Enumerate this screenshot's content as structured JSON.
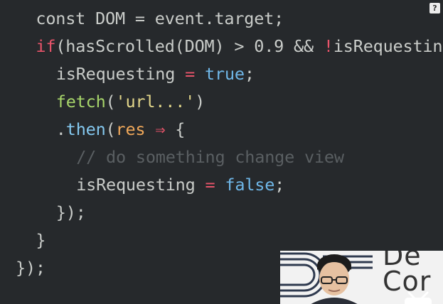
{
  "code_lines": [
    {
      "indent": 1,
      "tokens": [
        {
          "t": "const DOM = event.target;",
          "c": "plain"
        }
      ]
    },
    {
      "indent": 1,
      "tokens": [
        {
          "t": "if",
          "c": "kw"
        },
        {
          "t": "(hasScrolled(DOM) > 0.9 && ",
          "c": "plain"
        },
        {
          "t": "!",
          "c": "op"
        },
        {
          "t": "isRequesting",
          "c": "plain"
        }
      ]
    },
    {
      "indent": 2,
      "tokens": [
        {
          "t": "isRequesting ",
          "c": "plain"
        },
        {
          "t": "=",
          "c": "op"
        },
        {
          "t": " ",
          "c": "plain"
        },
        {
          "t": "true",
          "c": "bool"
        },
        {
          "t": ";",
          "c": "plain"
        }
      ]
    },
    {
      "indent": 2,
      "tokens": [
        {
          "t": "fetch",
          "c": "fn"
        },
        {
          "t": "(",
          "c": "plain"
        },
        {
          "t": "'url...'",
          "c": "str"
        },
        {
          "t": ")",
          "c": "plain"
        }
      ]
    },
    {
      "indent": 2,
      "tokens": [
        {
          "t": ".",
          "c": "plain"
        },
        {
          "t": "then",
          "c": "method"
        },
        {
          "t": "(",
          "c": "plain"
        },
        {
          "t": "res",
          "c": "param"
        },
        {
          "t": " ",
          "c": "plain"
        },
        {
          "t": "⇒",
          "c": "op"
        },
        {
          "t": " {",
          "c": "plain"
        }
      ]
    },
    {
      "indent": 3,
      "tokens": [
        {
          "t": "// do something change view",
          "c": "comment"
        }
      ]
    },
    {
      "indent": 3,
      "tokens": [
        {
          "t": "isRequesting ",
          "c": "plain"
        },
        {
          "t": "=",
          "c": "op"
        },
        {
          "t": " ",
          "c": "plain"
        },
        {
          "t": "false",
          "c": "bool"
        },
        {
          "t": ";",
          "c": "plain"
        }
      ]
    },
    {
      "indent": 2,
      "tokens": [
        {
          "t": "});",
          "c": "plain"
        }
      ]
    },
    {
      "indent": 1,
      "tokens": [
        {
          "t": "}",
          "c": "plain"
        }
      ]
    },
    {
      "indent": 0,
      "tokens": [
        {
          "t": "});",
          "c": "plain"
        }
      ]
    }
  ],
  "overlay": {
    "help_label": "?",
    "pip_text_line1": "De",
    "pip_text_line2": "Cor"
  },
  "colors": {
    "background": "#26292c",
    "plain": "#c9ccc9",
    "keyword": "#e8546a",
    "boolean": "#6fb7e8",
    "function": "#a7d56a",
    "string": "#e2d68a",
    "method": "#84c8ef",
    "param": "#f0a85a",
    "comment": "#5a5f62"
  }
}
